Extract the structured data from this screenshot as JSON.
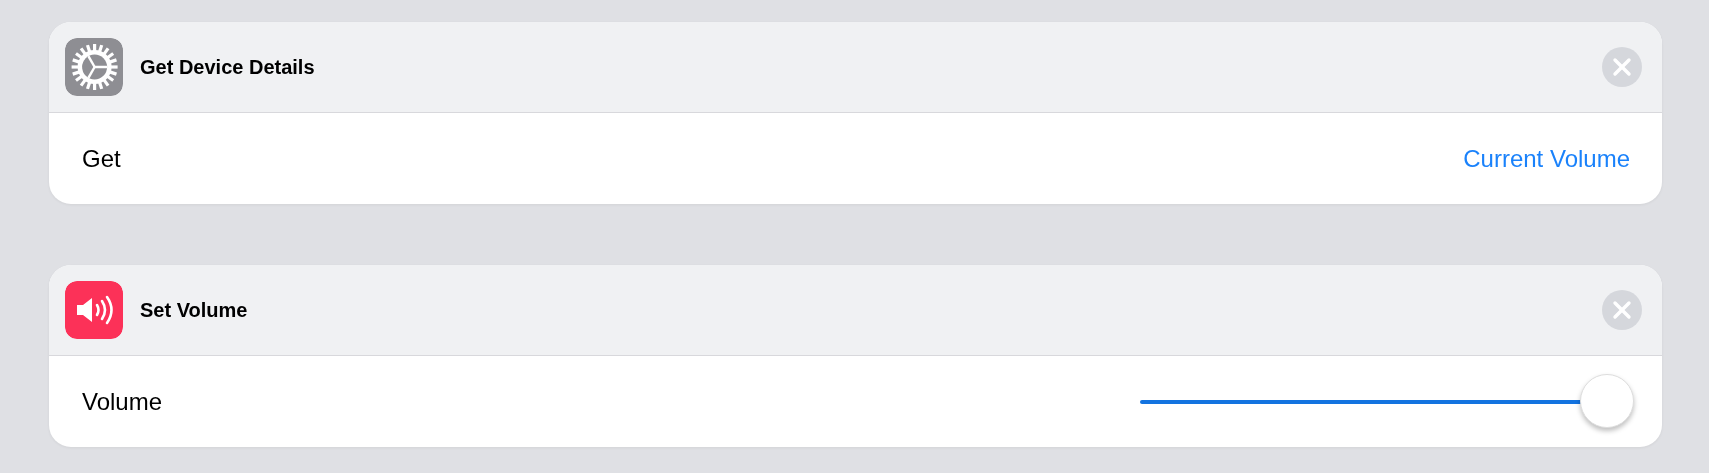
{
  "actions": [
    {
      "title": "Get Device Details",
      "parameter": {
        "kind": "value",
        "label": "Get",
        "value": "Current Volume"
      }
    },
    {
      "title": "Set Volume",
      "parameter": {
        "kind": "slider",
        "label": "Volume",
        "level": 1.0
      }
    }
  ]
}
